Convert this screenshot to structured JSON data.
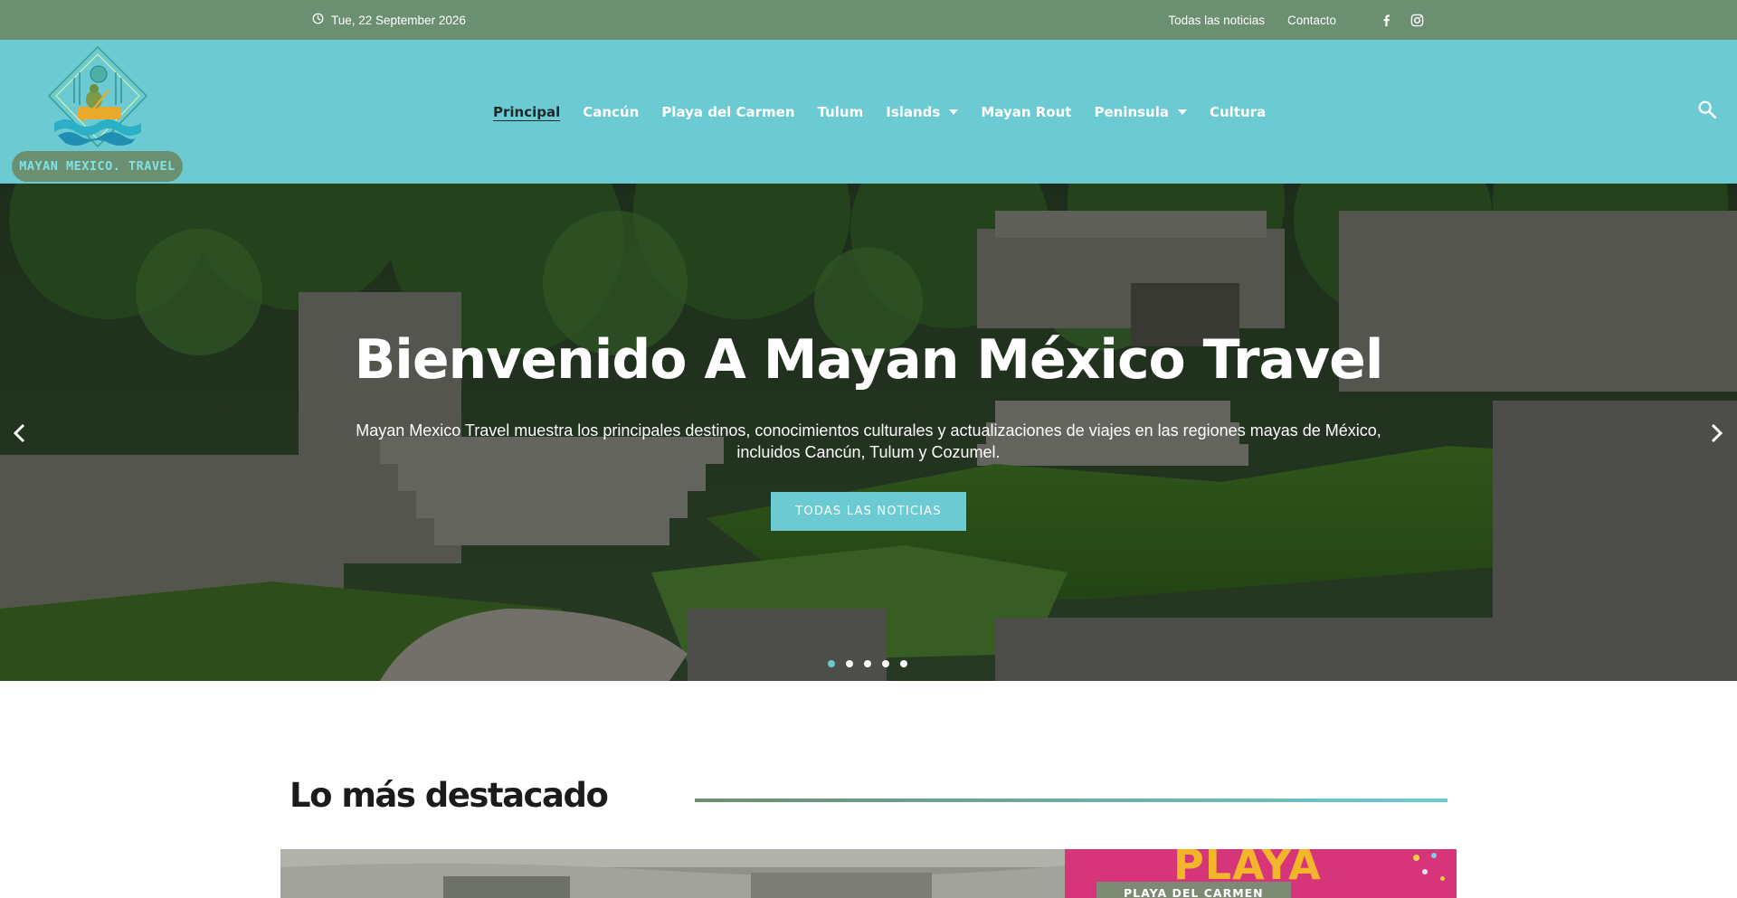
{
  "topbar": {
    "date": "Tue, 22 September 2026",
    "links": [
      "Todas las noticias",
      "Contacto"
    ],
    "social": [
      "facebook-icon",
      "instagram-icon"
    ],
    "background": "#6b8f71"
  },
  "header": {
    "background": "#6ccbd2",
    "logo_text": "MAYAN MEXICO. TRAVEL",
    "nav": [
      {
        "label": "Principal",
        "active": true,
        "dropdown": false
      },
      {
        "label": "Cancún",
        "active": false,
        "dropdown": false
      },
      {
        "label": "Playa del Carmen",
        "active": false,
        "dropdown": false
      },
      {
        "label": "Tulum",
        "active": false,
        "dropdown": false
      },
      {
        "label": "Islands",
        "active": false,
        "dropdown": true
      },
      {
        "label": "Mayan Rout",
        "active": false,
        "dropdown": false
      },
      {
        "label": "Peninsula",
        "active": false,
        "dropdown": true
      },
      {
        "label": "Cultura",
        "active": false,
        "dropdown": false
      }
    ],
    "search_icon": "search-icon"
  },
  "hero": {
    "title": "Bienvenido A Mayan México Travel",
    "text": "Mayan Mexico Travel muestra los principales destinos, conocimientos culturales y actualizaciones de viajes en las regiones mayas de México, incluidos Cancún, Tulum y Cozumel.",
    "button": "TODAS LAS NOTICIAS",
    "slides": 5,
    "active_slide": 1,
    "accent": "#6ccbd2"
  },
  "highlights": {
    "title": "Lo más destacado",
    "card_right_badge": "PLAYA DEL CARMEN",
    "card_right_art": "PLAYA"
  }
}
